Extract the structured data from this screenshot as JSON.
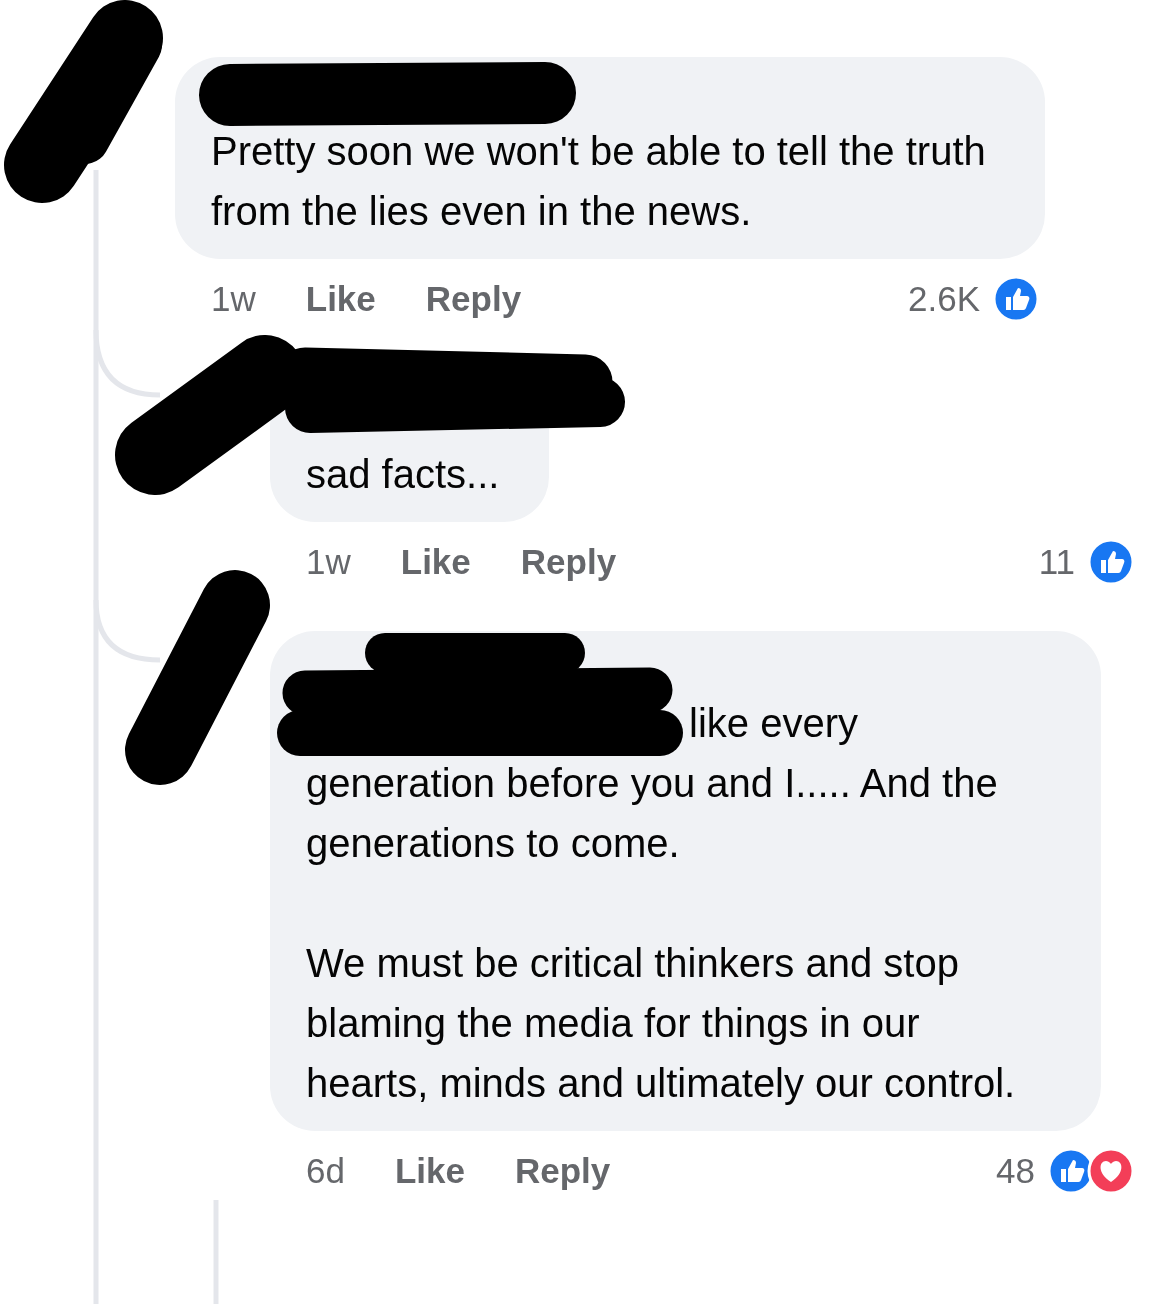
{
  "comments": [
    {
      "author_redacted": true,
      "paragraphs": [
        "Pretty soon we won't be able to tell the truth from the lies even in the news."
      ],
      "time": "1w",
      "actions": [
        "Like",
        "Reply"
      ],
      "reaction_count": "2.6K",
      "reactions": [
        {
          "kind": "like"
        }
      ]
    },
    {
      "author_redacted": true,
      "paragraphs": [
        "sad facts..."
      ],
      "time": "1w",
      "actions": [
        "Like",
        "Reply"
      ],
      "reaction_count": "11",
      "reactions": [
        {
          "kind": "like"
        }
      ]
    },
    {
      "author_redacted": true,
      "mention_redacted": true,
      "paragraphs": [
        "like every generation before you and I..... And the generations to come.",
        "We must be critical thinkers and stop blaming the media for things in our hearts, minds and ultimately our control."
      ],
      "time": "6d",
      "actions": [
        "Like",
        "Reply"
      ],
      "reaction_count": "48",
      "reactions": [
        {
          "kind": "like"
        },
        {
          "kind": "love"
        }
      ]
    }
  ]
}
